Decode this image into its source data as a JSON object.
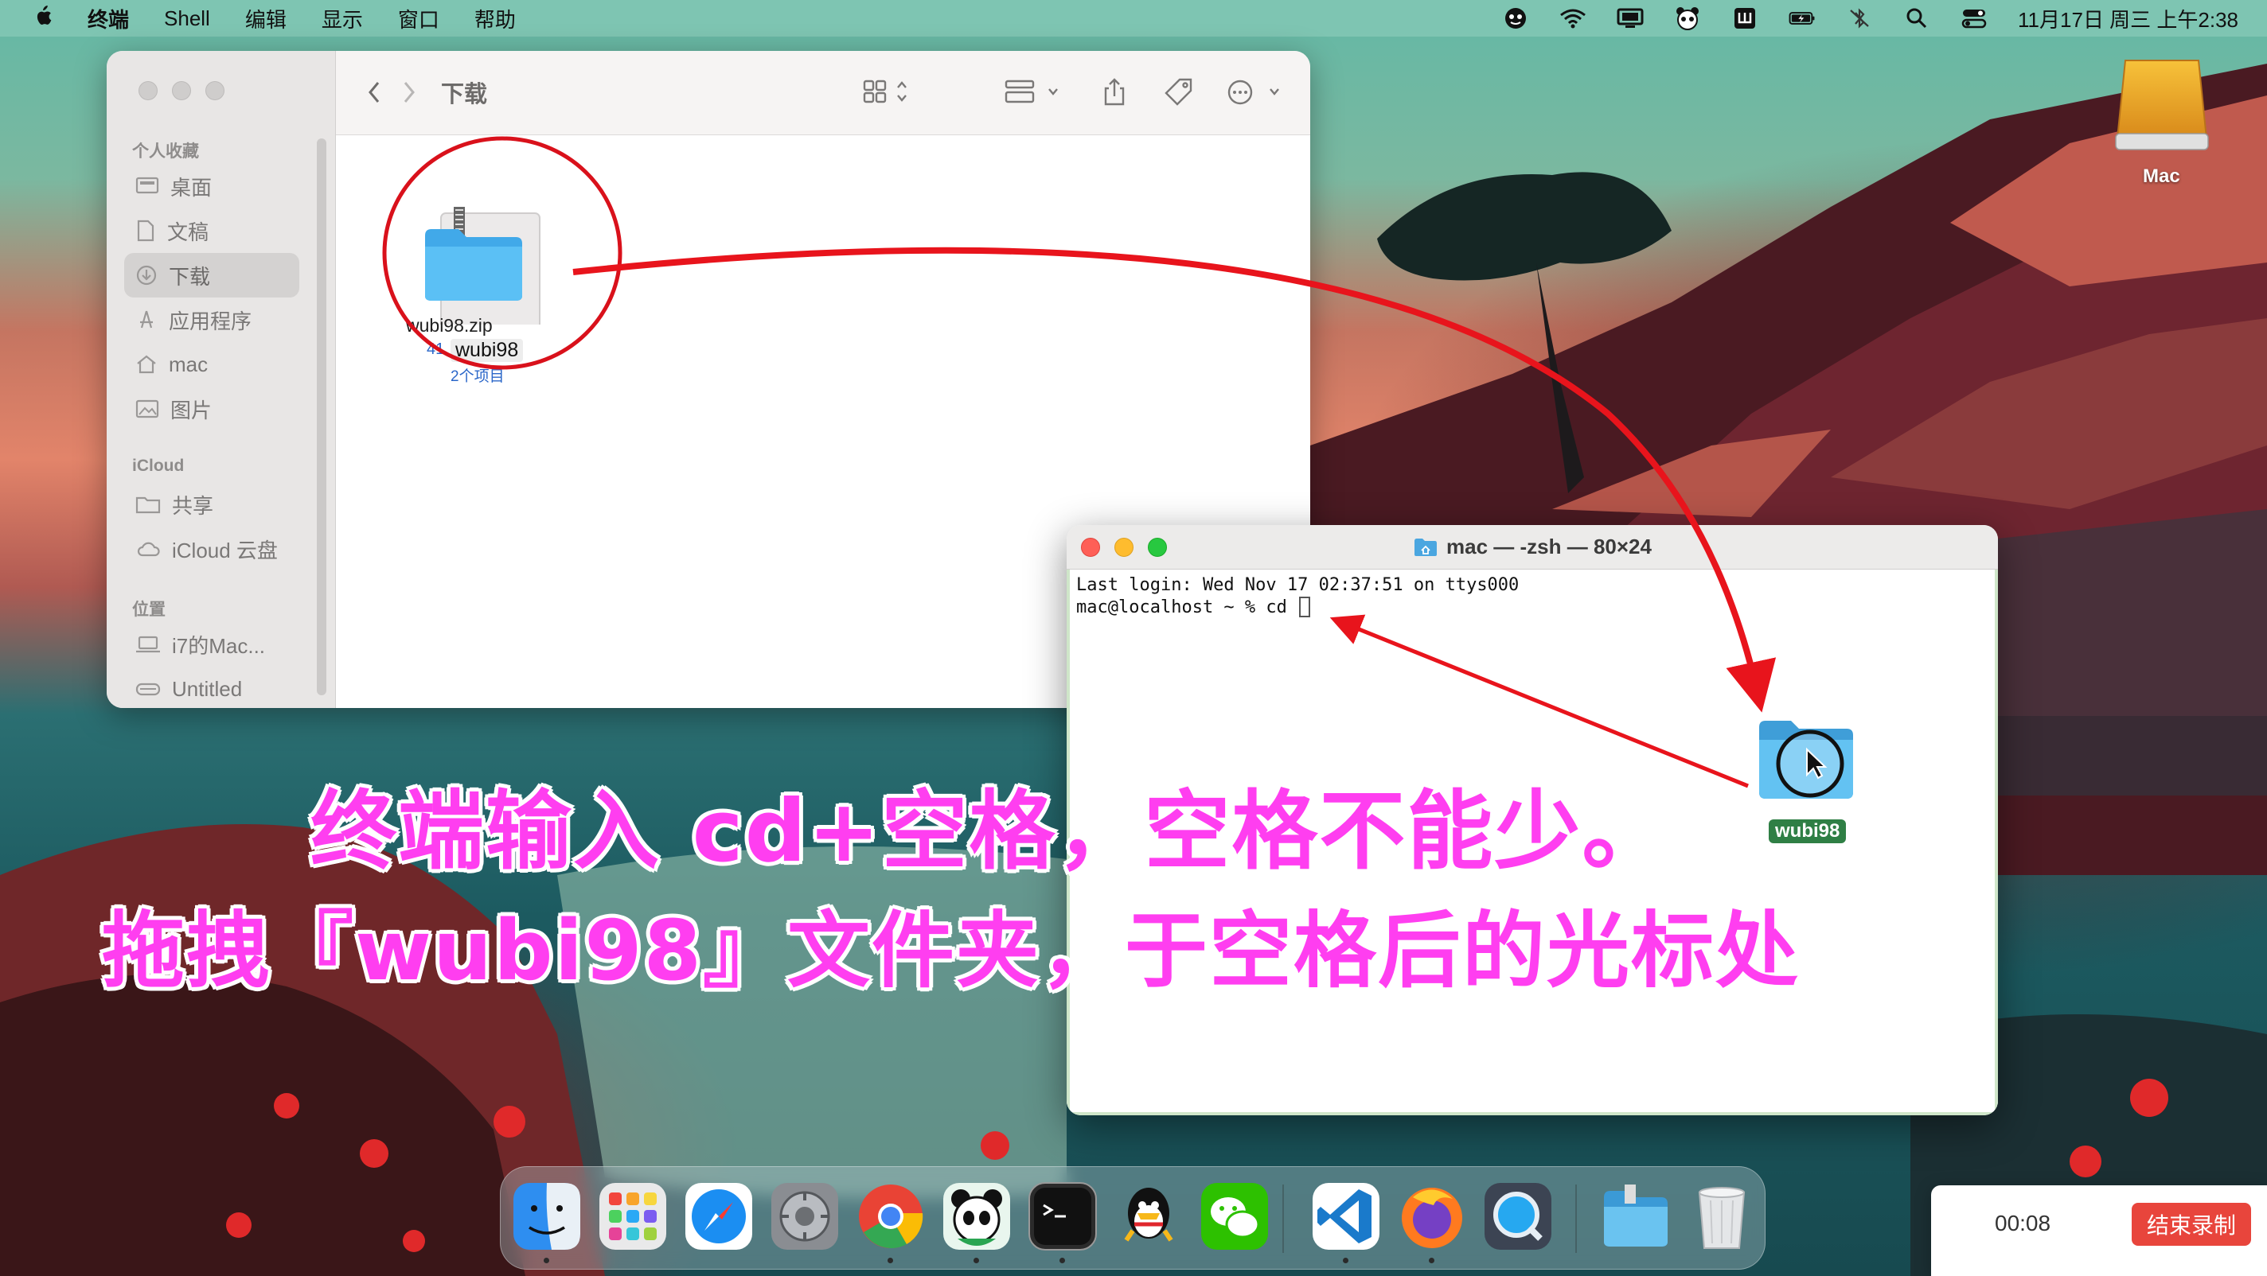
{
  "menubar": {
    "app_name": "终端",
    "menus": [
      "Shell",
      "编辑",
      "显示",
      "窗口",
      "帮助"
    ],
    "clock": "11月17日 周三 上午2:38"
  },
  "finder": {
    "title": "下载",
    "sidebar": {
      "favorites_header": "个人收藏",
      "favorites": [
        "桌面",
        "文稿",
        "下载",
        "应用程序",
        "mac",
        "图片"
      ],
      "icloud_header": "iCloud",
      "icloud": [
        "共享",
        "iCloud 云盘"
      ],
      "locations_header": "位置",
      "locations": [
        "i7的Mac...",
        "Untitled"
      ]
    },
    "file": {
      "name": "wubi98.zip",
      "size_partial": "41",
      "drag_name": "wubi98",
      "drag_count": "2个项目"
    }
  },
  "terminal": {
    "title": "mac — -zsh — 80×24",
    "line1": "Last login: Wed Nov 17 02:37:51 on ttys000",
    "prompt": "mac@localhost ~ % cd "
  },
  "desktop": {
    "drive_label": "Mac",
    "folder_label": "wubi98"
  },
  "caption": {
    "line1": "终端输入 cd+空格，空格不能少。",
    "line2": "拖拽『wubi98』文件夹，于空格后的光标处"
  },
  "recording": {
    "elapsed": "00:08",
    "stop_label": "结束录制"
  },
  "colors": {
    "caption": "#ff3ef0",
    "arrow": "#e8141c",
    "stop_button": "#e8453c"
  }
}
